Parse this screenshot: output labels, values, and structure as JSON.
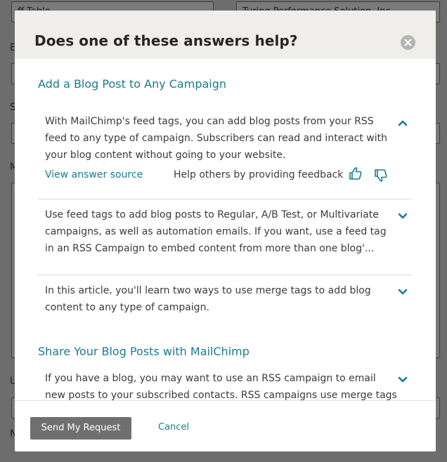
{
  "background": {
    "field_top_left": "ff Table",
    "field_top_right": "Turing Performance Solution, Inc.",
    "labels": [
      "E",
      "S",
      "M",
      "U",
      "N"
    ]
  },
  "modal": {
    "title": "Does one of these answers help?",
    "close_icon": "close-icon",
    "sections": [
      {
        "title": "Add a Blog Post to Any Campaign",
        "answers": [
          {
            "text": "With MailChimp's feed tags, you can add blog posts from your RSS feed to any type of campaign. Subscribers can read and interact with your blog content without going to your website.",
            "expanded": true,
            "source_label": "View answer source",
            "feedback_label": "Help others by providing feedback"
          },
          {
            "text": "Use feed tags to add blog posts to Regular, A/B Test, or Multivariate campaigns, as well as automation emails. If you want, use a feed tag in an RSS Campaign to embed content from more than one blog'...",
            "expanded": false
          },
          {
            "text": "In this article, you'll learn two ways to use merge tags to add blog content to any type of campaign.",
            "expanded": false
          }
        ]
      },
      {
        "title": "Share Your Blog Posts with MailChimp",
        "answers": [
          {
            "text": "If you have a blog, you may want to use an RSS campaign to email new posts to your subscribed contacts. RSS campaigns use merge tags to",
            "expanded": false
          }
        ]
      }
    ],
    "footer": {
      "send_label": "Send My Request",
      "cancel_label": "Cancel"
    }
  },
  "colors": {
    "accent": "#1c7a91",
    "header_bg": "#efeeea",
    "button_bg": "#6f6f6f",
    "overlay": "#6d6d6d"
  }
}
